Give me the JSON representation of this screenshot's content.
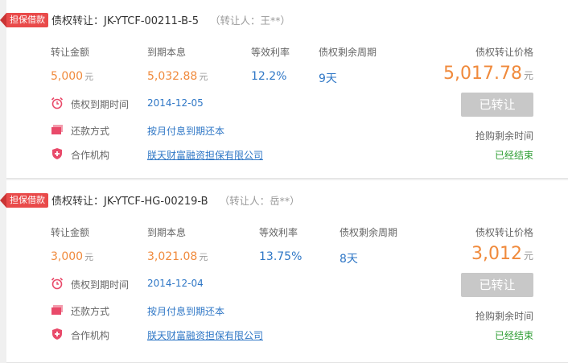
{
  "cards": [
    {
      "tag": "担保借款",
      "title": "债权转让：JK-YTCF-00211-B-5",
      "transferor": "（转让人：王**）",
      "labels": {
        "amount": "转让金额",
        "principal": "到期本息",
        "rate": "等效利率",
        "period": "债权剩余周期",
        "price": "债权转让价格"
      },
      "values": {
        "amount": "5,000",
        "amount_unit": "元",
        "principal": "5,032.88",
        "principal_unit": "元",
        "rate": "12.2%",
        "period": "9天",
        "price": "5,017.78",
        "price_unit": "元"
      },
      "due_label": "债权到期时间",
      "due_date": "2014-12-05",
      "repay_label": "还款方式",
      "repay_method": "按月付息到期还本",
      "partner_label": "合作机构",
      "partner_name": "朕天财富融资担保有限公司",
      "button": "已转让",
      "remain_label": "抢购剩余时间",
      "status": "已经结束"
    },
    {
      "tag": "担保借款",
      "title": "债权转让：JK-YTCF-HG-00219-B",
      "transferor": "（转让人：岳**）",
      "labels": {
        "amount": "转让金额",
        "principal": "到期本息",
        "rate": "等效利率",
        "period": "债权剩余周期",
        "price": "债权转让价格"
      },
      "values": {
        "amount": "3,000",
        "amount_unit": "元",
        "principal": "3,021.08",
        "principal_unit": "元",
        "rate": "13.75%",
        "period": "8天",
        "price": "3,012",
        "price_unit": "元"
      },
      "due_label": "债权到期时间",
      "due_date": "2014-12-04",
      "repay_label": "还款方式",
      "repay_method": "按月付息到期还本",
      "partner_label": "合作机构",
      "partner_name": "朕天财富融资担保有限公司",
      "button": "已转让",
      "remain_label": "抢购剩余时间",
      "status": "已经结束"
    }
  ],
  "colors": {
    "accent_orange": "#f08a3c",
    "link_blue": "#2f77c6",
    "status_green": "#2f9e34",
    "tag_red": "#e94a4a",
    "disabled_button": "#c8c8c8"
  },
  "icons": {
    "due": "alarm-clock-icon",
    "repay": "cards-icon",
    "partner": "shield-plus-icon"
  }
}
